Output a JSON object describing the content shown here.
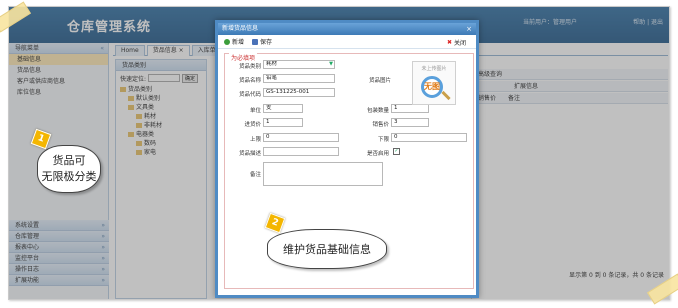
{
  "header": {
    "title": "仓库管理系统",
    "user": "当前用户：管理用户",
    "help": "帮助 | 退出"
  },
  "sidebar": {
    "title": "导航菜单",
    "group": "基础信息",
    "items": [
      {
        "label": "货品信息"
      },
      {
        "label": "客户或供应商信息"
      },
      {
        "label": "库位信息"
      }
    ],
    "bottom": [
      {
        "label": "系统设置"
      },
      {
        "label": "仓库管理"
      },
      {
        "label": "报表中心"
      },
      {
        "label": "监控平台"
      },
      {
        "label": "操作日志"
      },
      {
        "label": "扩展功能"
      }
    ]
  },
  "tabs": [
    {
      "label": "Home"
    },
    {
      "label": "货品信息 ×"
    },
    {
      "label": "入库单"
    }
  ],
  "tree": {
    "title": "货品类别",
    "quick_label": "快速定位:",
    "quick_button": "确定",
    "nodes": [
      {
        "label": "货品类别",
        "level": 0
      },
      {
        "label": "默认类别",
        "level": 1
      },
      {
        "label": "文具类",
        "level": 1
      },
      {
        "label": "耗材",
        "level": 2
      },
      {
        "label": "非耗材",
        "level": 2
      },
      {
        "label": "电器类",
        "level": 1
      },
      {
        "label": "数码",
        "level": 2
      },
      {
        "label": "家电",
        "level": 2
      }
    ]
  },
  "grid": {
    "search_label": "高级查询",
    "col1": "扩展信息",
    "col_unit": "销售价",
    "col_note": "备注",
    "footer": "显示第 0 到 0 条记录，共 0 条记录"
  },
  "dialog": {
    "title": "新增货品信息",
    "toolbar": {
      "new": "新增",
      "save": "保存",
      "close": "关闭"
    },
    "section": "为必填项",
    "fields": {
      "category_label": "货品类别",
      "category_value": "耗材",
      "name_label": "货品名称",
      "name_value": "铅笔",
      "code_label": "货品代码",
      "code_value": "GS-131225-001",
      "image_label": "货品图片",
      "image_caption": "未上传图片",
      "image_text": "无图",
      "unit_label": "单位",
      "unit_value": "支",
      "pack_label": "包装数量",
      "pack_value": "1",
      "in_price_label": "进货价",
      "in_price_value": "1",
      "sale_price_label": "销售价",
      "sale_price_value": "3",
      "upper_label": "上限",
      "upper_value": "0",
      "lower_label": "下限",
      "lower_value": "0",
      "desc_label": "货品描述",
      "enabled_label": "是否启用",
      "note_label": "备注"
    }
  },
  "callouts": [
    {
      "num": "1",
      "text1": "货品可",
      "text2": "无限极分类"
    },
    {
      "num": "2",
      "text": "维护货品基础信息"
    }
  ],
  "colors": {
    "primary": "#2f6fa3",
    "accent": "#f4b600",
    "dialog_border": "#4f8bc4"
  }
}
